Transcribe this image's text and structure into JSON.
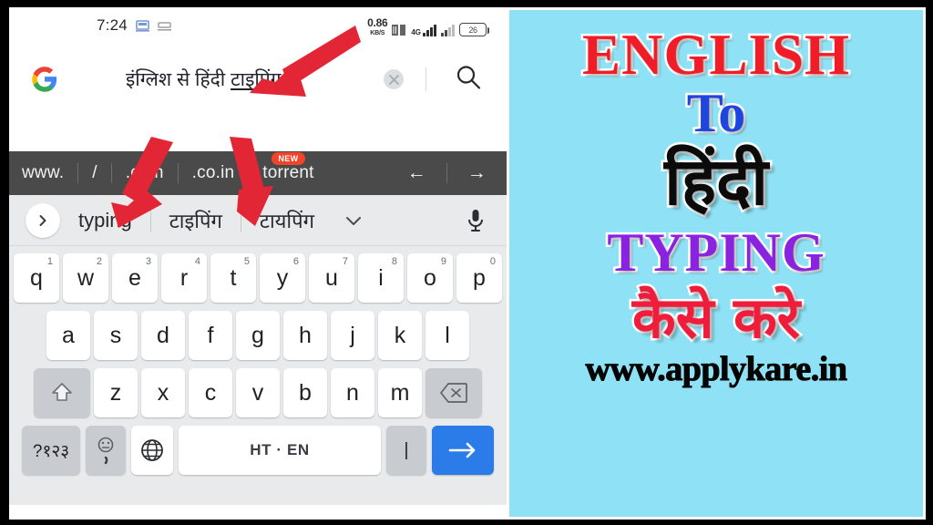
{
  "poster": {
    "background_color": "#8FE2F5",
    "lines": [
      {
        "text": "ENGLISH",
        "color": "#F01C28"
      },
      {
        "text": "To",
        "color": "#1F45DF"
      },
      {
        "text": "हिंदी",
        "color": "#0B0B0B"
      },
      {
        "text": "TYPING",
        "color": "#8A23E0"
      },
      {
        "text": "कैसे करे",
        "color": "#F01C3C"
      }
    ],
    "english_label": "ENGLISH",
    "to_label": "To",
    "hindi_label": "हिंदी",
    "typing_label": "TYPING",
    "kaise_kare_label": "कैसे करे",
    "website_url": "www.applykare.in"
  },
  "phone": {
    "statusbar": {
      "time": "7:24",
      "data_speed_value": "0.86",
      "data_speed_unit": "KB/S",
      "network_type": "4G",
      "battery_percent": "26"
    },
    "search": {
      "query_prefix": "इंग्लिश से हिंदी ",
      "query_underlined": "टाइपिंग",
      "full_query": "इंग्लिश से हिंदी टाइपिंग",
      "logo": "google-g-logo",
      "clear_icon": "clear-icon",
      "search_icon": "search-icon"
    },
    "url_strip": {
      "items": [
        {
          "label": "www."
        },
        {
          "label": "/"
        },
        {
          "label": ".com"
        },
        {
          "label": ".co.in"
        },
        {
          "label": "torrent",
          "badge": "NEW"
        }
      ],
      "back_label": "←",
      "forward_label": "→"
    },
    "suggestions": {
      "expand_icon": "chevron-right-icon",
      "items": [
        "typing",
        "टाइपिंग",
        "टायपिंग"
      ],
      "more_icon": "chevron-down-icon",
      "mic_icon": "microphone-icon"
    },
    "keyboard": {
      "row1": [
        {
          "key": "q",
          "num": "1"
        },
        {
          "key": "w",
          "num": "2"
        },
        {
          "key": "e",
          "num": "3"
        },
        {
          "key": "r",
          "num": "4"
        },
        {
          "key": "t",
          "num": "5"
        },
        {
          "key": "y",
          "num": "6"
        },
        {
          "key": "u",
          "num": "7"
        },
        {
          "key": "i",
          "num": "8"
        },
        {
          "key": "o",
          "num": "9"
        },
        {
          "key": "p",
          "num": "0"
        }
      ],
      "row2": [
        "a",
        "s",
        "d",
        "f",
        "g",
        "h",
        "j",
        "k",
        "l"
      ],
      "row3": [
        "z",
        "x",
        "c",
        "v",
        "b",
        "n",
        "m"
      ],
      "shift_icon": "shift-icon",
      "backspace_icon": "backspace-icon",
      "symbols_label": "?१२३",
      "emoji_icon": "emoji-comma-icon",
      "globe_icon": "globe-language-icon",
      "space_label": "HT · EN",
      "bar_label": "|",
      "enter_icon": "enter-arrow-icon",
      "enter_color": "#2B7CE9"
    }
  },
  "annotations": {
    "arrow_color": "#E32636",
    "arrows": [
      {
        "name": "arrow-to-search-field"
      },
      {
        "name": "arrow-to-suggestion-typing"
      },
      {
        "name": "arrow-to-suggestion-hindi-typing"
      }
    ]
  }
}
